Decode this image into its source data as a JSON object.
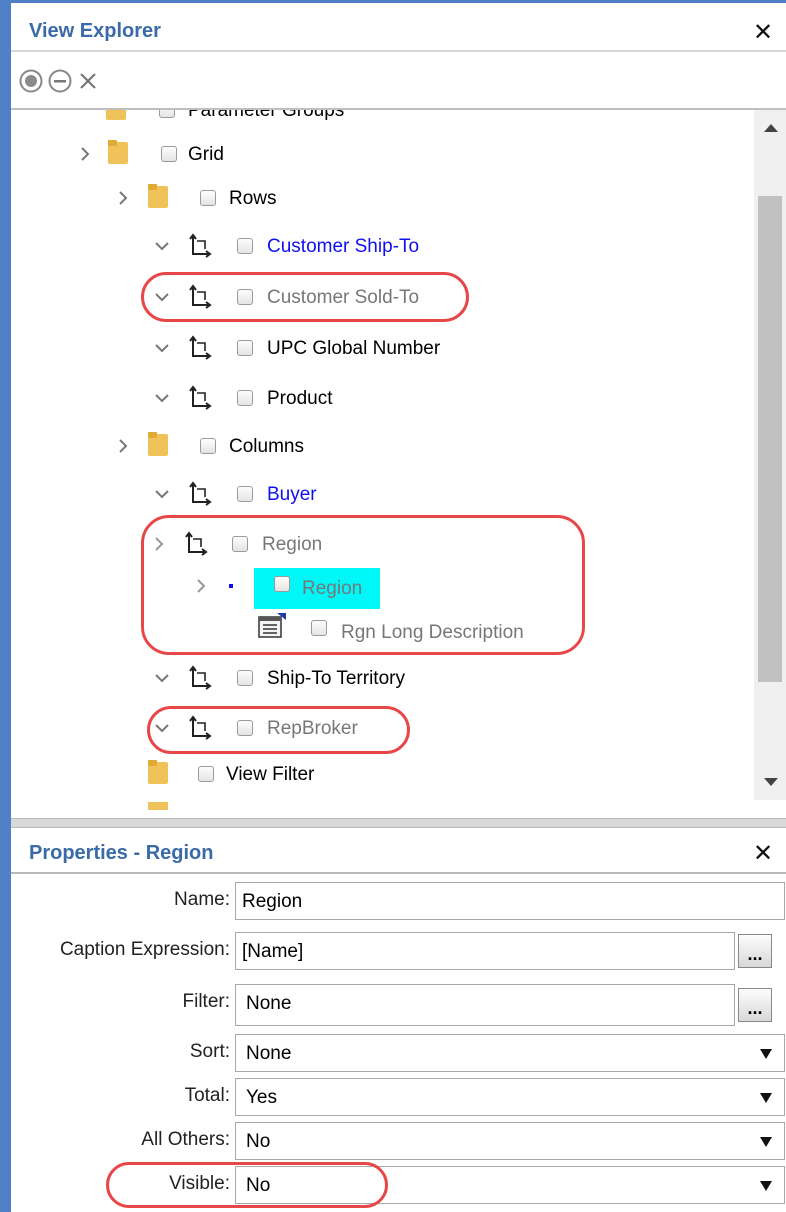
{
  "explorer": {
    "title": "View Explorer",
    "toolbar": [
      "expand-all-icon",
      "collapse-all-icon",
      "clear-icon"
    ],
    "tree": {
      "parameter_groups": "Parameter Groups",
      "grid": "Grid",
      "rows": "Rows",
      "customer_ship_to": "Customer Ship-To",
      "customer_sold_to": "Customer Sold-To",
      "upc_global_number": "UPC Global Number",
      "product": "Product",
      "columns": "Columns",
      "buyer": "Buyer",
      "region": "Region",
      "region_child": "Region",
      "rgn_long_description": "Rgn Long Description",
      "ship_to_territory": "Ship-To Territory",
      "repbroker": "RepBroker",
      "view_filter": "View Filter"
    }
  },
  "properties": {
    "title": "Properties - Region",
    "rows": [
      {
        "label": "Name:",
        "value": "Region",
        "type": "text"
      },
      {
        "label": "Caption Expression:",
        "value": "[Name]",
        "type": "ellipsis"
      },
      {
        "label": "Filter:",
        "value": "None",
        "type": "ellipsis"
      },
      {
        "label": "Sort:",
        "value": "None",
        "type": "select"
      },
      {
        "label": "Total:",
        "value": "Yes",
        "type": "select"
      },
      {
        "label": "All Others:",
        "value": "No",
        "type": "select"
      },
      {
        "label": "Visible:",
        "value": "No",
        "type": "select"
      }
    ],
    "ellipsis_label": "..."
  },
  "colors": {
    "accent_blue": "#3a6ba8",
    "link_blue": "#1010ee",
    "highlight_red": "#e8474a",
    "selection_cyan": "#00f7f7"
  }
}
